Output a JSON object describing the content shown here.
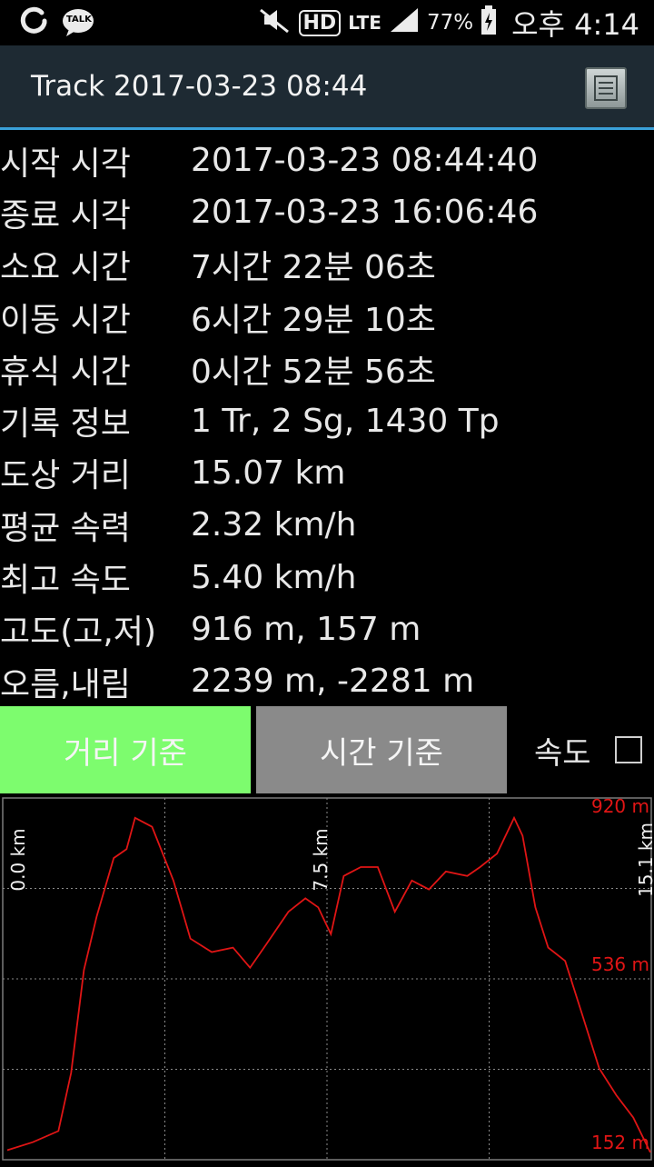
{
  "status_bar": {
    "left_icons": [
      "g-icon",
      "talk-icon"
    ],
    "talk_badge": "TALK",
    "hd": "HD",
    "network": "LTE",
    "battery": "77%",
    "time": "오후 4:14"
  },
  "action_bar": {
    "title": "Track 2017-03-23 08:44"
  },
  "info_rows": [
    {
      "label": "시작 시각",
      "value": "2017-03-23 08:44:40"
    },
    {
      "label": "종료 시각",
      "value": "2017-03-23 16:06:46"
    },
    {
      "label": "소요 시간",
      "value": "7시간 22분 06초"
    },
    {
      "label": "이동 시간",
      "value": "6시간 29분 10초"
    },
    {
      "label": "휴식 시간",
      "value": "0시간 52분 56초"
    },
    {
      "label": "기록 정보",
      "value": "1 Tr, 2 Sg, 1430 Tp"
    },
    {
      "label": "도상 거리",
      "value": "15.07 km"
    },
    {
      "label": "평균 속력",
      "value": "2.32 km/h"
    },
    {
      "label": "최고 속도",
      "value": "5.40 km/h"
    },
    {
      "label": "고도(고,저)",
      "value": "916 m, 157 m"
    },
    {
      "label": "오름,내림",
      "value": "2239 m, -2281 m"
    }
  ],
  "buttons": {
    "distance": "거리 기준",
    "time": "시간 기준",
    "speed_label": "속도",
    "speed_checked": false
  },
  "colors": {
    "line": "#e01515",
    "active_button": "#7dfc6e",
    "inactive_button": "#8a8a8a",
    "action_bar": "#1e2a33",
    "accent": "#3aa0d8"
  },
  "chart_data": {
    "type": "line",
    "xlabel": "",
    "ylabel": "",
    "xlim": [
      0,
      15.1
    ],
    "ylim": [
      152,
      920
    ],
    "x_tick_labels": [
      "0.0 km",
      "7.5 km",
      "15.1 km"
    ],
    "x_ticks": [
      0.0,
      7.5,
      15.1
    ],
    "y_tick_labels": [
      "920 m",
      "536 m",
      "152 m"
    ],
    "y_ticks": [
      920,
      536,
      152
    ],
    "grid": true,
    "series": [
      {
        "values_x": [
          0,
          0.6,
          1.2,
          1.5,
          1.8,
          2.1,
          2.5,
          2.8,
          3.0,
          3.4,
          3.9,
          4.3,
          4.8,
          5.3,
          5.7,
          6.1,
          6.6,
          7.0,
          7.3,
          7.6,
          7.9,
          8.3,
          8.7,
          9.1,
          9.5,
          9.9,
          10.3,
          10.8,
          11.1,
          11.5,
          11.9,
          12.1,
          12.4,
          12.7,
          13.1,
          13.5,
          13.9,
          14.3,
          14.7,
          15.1
        ],
        "values_y": [
          157,
          175,
          200,
          330,
          560,
          680,
          810,
          830,
          900,
          880,
          760,
          630,
          600,
          610,
          565,
          620,
          690,
          720,
          700,
          640,
          770,
          790,
          790,
          690,
          760,
          740,
          780,
          770,
          790,
          820,
          900,
          860,
          700,
          610,
          580,
          460,
          340,
          280,
          230,
          152
        ]
      }
    ]
  }
}
